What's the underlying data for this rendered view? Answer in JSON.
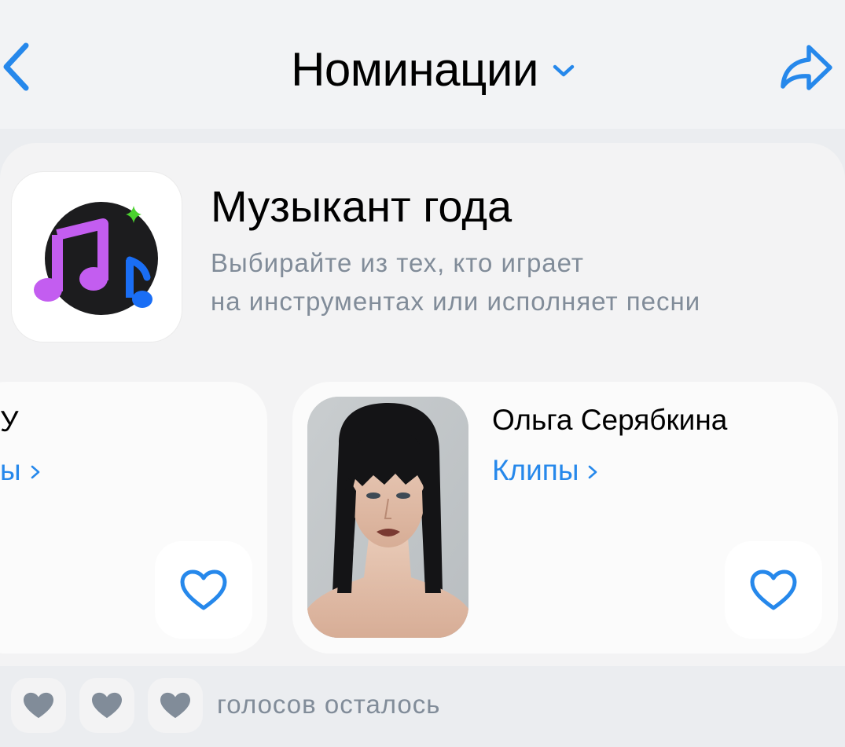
{
  "header": {
    "title": "Номинации",
    "back_icon": "chevron-left-icon",
    "dropdown_icon": "chevron-down-icon",
    "share_icon": "share-arrow-icon"
  },
  "nomination": {
    "title": "Музыкант года",
    "description_line1": "Выбирайте из тех, кто играет",
    "description_line2": "на инструментах или исполняет песни",
    "icon": "music-notes-icon"
  },
  "candidates": [
    {
      "name": "У",
      "link_label": "ы",
      "partially_visible": true
    },
    {
      "name": "Ольга Серябкина",
      "link_label": "Клипы",
      "photo": "portrait-photo"
    }
  ],
  "votes": {
    "label": "голосов осталось",
    "hearts_count": 3
  },
  "colors": {
    "accent": "#2688eb",
    "secondary_text": "#818c99",
    "heart_filled": "#818c99",
    "note_purple": "#c35df0",
    "note_blue": "#1a6ef5",
    "sparkle_green": "#4bd12f"
  }
}
